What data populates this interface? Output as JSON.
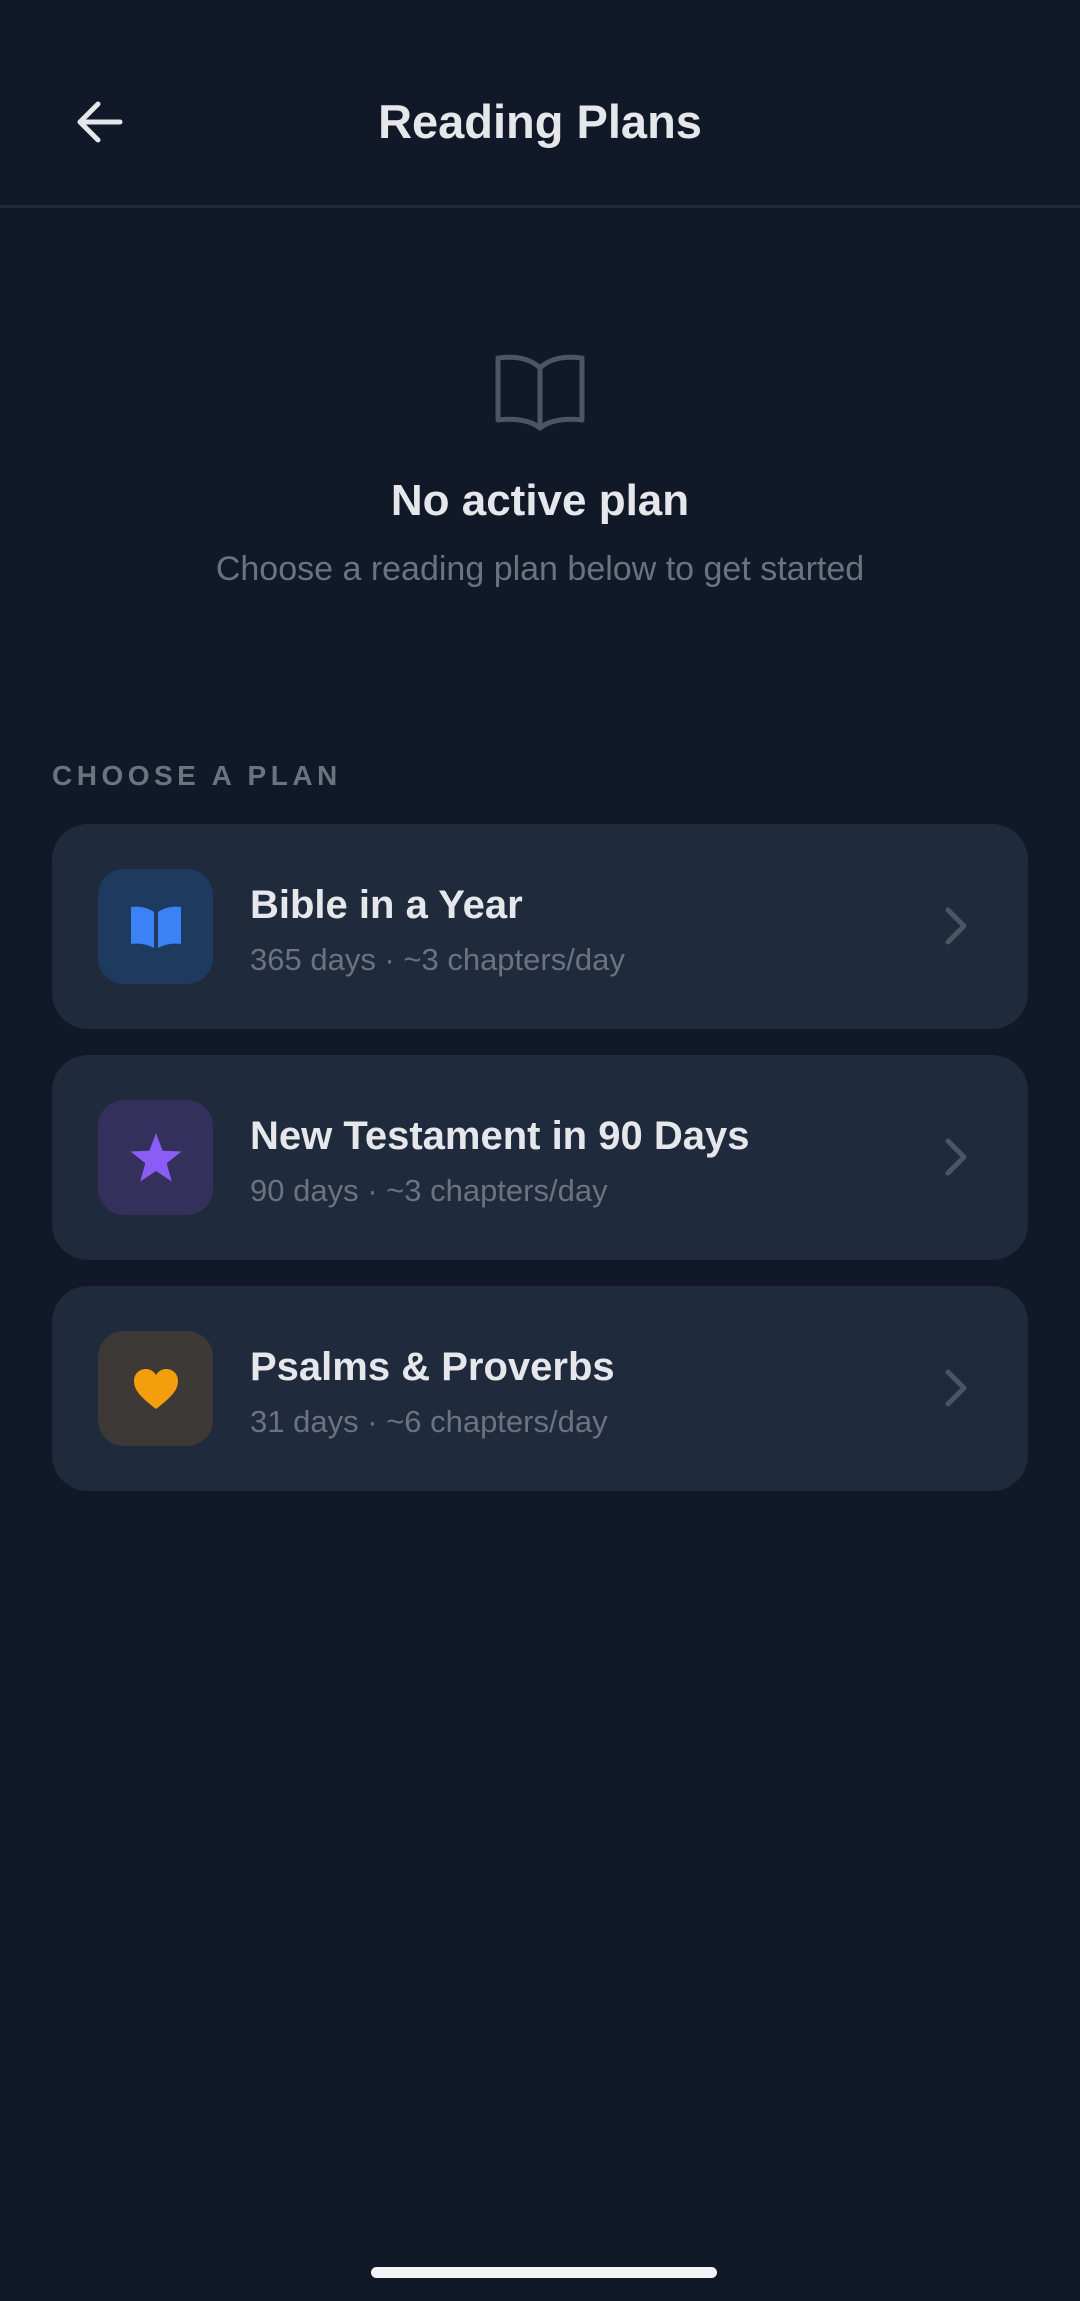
{
  "header": {
    "title": "Reading Plans",
    "back_icon": "arrow-left-icon"
  },
  "empty_state": {
    "icon": "open-book-icon",
    "title": "No active plan",
    "subtitle": "Choose a reading plan below to get started"
  },
  "section": {
    "label": "CHOOSE A PLAN"
  },
  "plans": [
    {
      "name": "Bible in a Year",
      "meta": "365 days · ~3 chapters/day",
      "icon": "book-icon",
      "accent": "#3b82f6",
      "icon_bg": "#1e3a5f"
    },
    {
      "name": "New Testament in 90 Days",
      "meta": "90 days · ~3 chapters/day",
      "icon": "star-icon",
      "accent": "#8b5cf6",
      "icon_bg": "#33305c"
    },
    {
      "name": "Psalms & Proverbs",
      "meta": "31 days · ~6 chapters/day",
      "icon": "heart-icon",
      "accent": "#f59e0b",
      "icon_bg": "#3d3936"
    }
  ],
  "colors": {
    "background": "#111827",
    "card": "#1f2a3c",
    "text_primary": "#e5e7eb",
    "text_secondary": "#6b7280"
  }
}
